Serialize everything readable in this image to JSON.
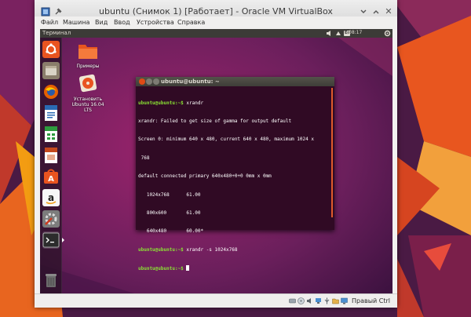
{
  "window": {
    "title": "ubuntu (Снимок 1) [Работает] - Oracle VM VirtualBox",
    "close_glyph": "✕"
  },
  "menubar": [
    "Файл",
    "Машина",
    "Вид",
    "Ввод",
    "Устройства",
    "Справка"
  ],
  "guest": {
    "topbar_title": "Терминал",
    "tray": {
      "keyboard_layout": "En",
      "time": "08:17"
    },
    "launcher_items": [
      {
        "name": "ubuntu-dash-icon",
        "color": "#e95420"
      },
      {
        "name": "files-icon",
        "color": "#8a7e6b"
      },
      {
        "name": "firefox-icon",
        "color": "#e66000"
      },
      {
        "name": "writer-icon",
        "color": "#2a6ab3"
      },
      {
        "name": "calc-icon",
        "color": "#2e9b3f"
      },
      {
        "name": "impress-icon",
        "color": "#c5491d"
      },
      {
        "name": "software-center-icon",
        "color": "#e95420"
      },
      {
        "name": "amazon-icon",
        "color": "#f0a01a"
      },
      {
        "name": "settings-icon",
        "color": "#cf3a1f"
      },
      {
        "name": "terminal-icon",
        "color": "#2c2c2c"
      },
      {
        "name": "trash-icon",
        "color": "#6b6b6b"
      }
    ],
    "desktop_icons": [
      {
        "label": "Примеры"
      },
      {
        "label": "Установить Ubuntu 16.04 LTS"
      }
    ]
  },
  "terminal": {
    "title": "ubuntu@ubuntu: ~",
    "lines": [
      {
        "prompt": "ubuntu@ubuntu:~$",
        "text": " xrandr"
      },
      {
        "prompt": "",
        "text": "xrandr: Failed to get size of gamma for output default"
      },
      {
        "prompt": "",
        "text": "Screen 0: minimum 640 x 480, current 640 x 480, maximum 1024 x"
      },
      {
        "prompt": "",
        "text": " 768"
      },
      {
        "prompt": "",
        "text": "default connected primary 640x480+0+0 0mm x 0mm"
      },
      {
        "prompt": "",
        "text": "   1024x768      61.00"
      },
      {
        "prompt": "",
        "text": "   800x600       61.00"
      },
      {
        "prompt": "",
        "text": "   640x480       60.00*"
      },
      {
        "prompt": "ubuntu@ubuntu:~$",
        "text": " xrandr -s 1024x768"
      },
      {
        "prompt": "ubuntu@ubuntu:~$",
        "text": " "
      }
    ]
  },
  "statusbar": {
    "hostkey_label": "Правый Ctrl"
  },
  "colors": {
    "accent": "#e95420",
    "terminal_bg": "#300a24",
    "prompt": "#8ae234"
  }
}
